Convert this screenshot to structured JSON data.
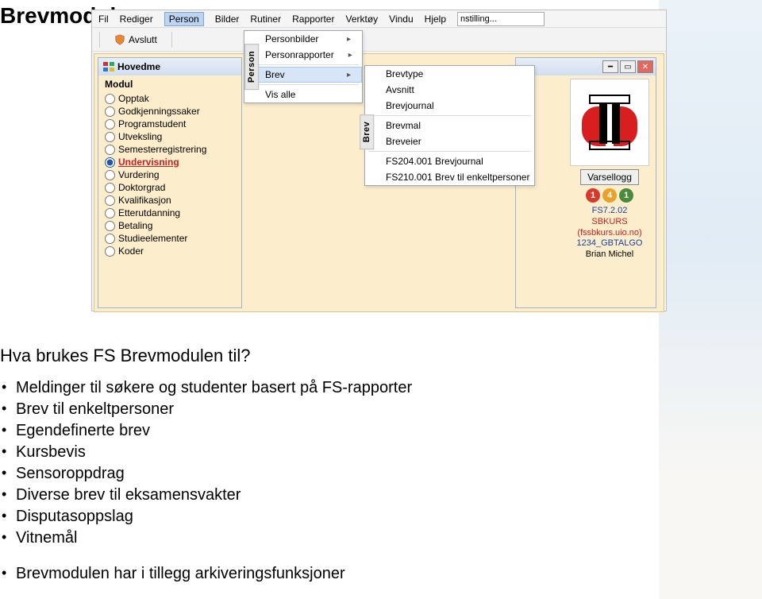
{
  "slide_title": "Brevmodulen",
  "menubar": [
    "Fil",
    "Rediger",
    "Person",
    "Bilder",
    "Rutiner",
    "Rapporter",
    "Verktøy",
    "Vindu",
    "Hjelp"
  ],
  "menubar_active_index": 2,
  "toolbar": {
    "avslutt": "Avslutt"
  },
  "stilling_value": "nstilling...",
  "person_menu": {
    "tab": "Person",
    "items": [
      {
        "label": "Personbilder",
        "arrow": true
      },
      {
        "label": "Personrapporter",
        "arrow": true
      },
      {
        "sep": true
      },
      {
        "label": "Brev",
        "arrow": true,
        "active": true
      },
      {
        "sep": true
      },
      {
        "label": "Vis alle"
      }
    ]
  },
  "brev_menu": {
    "tab": "Brev",
    "items": [
      {
        "label": "Brevtype"
      },
      {
        "label": "Avsnitt"
      },
      {
        "label": "Brevjournal"
      },
      {
        "sep": true
      },
      {
        "label": "Brevmal"
      },
      {
        "label": "Breveier"
      },
      {
        "sep": true
      },
      {
        "label": "FS204.001 Brevjournal"
      },
      {
        "label": "FS210.001 Brev til enkeltpersoner"
      }
    ]
  },
  "child_window": {
    "title": "Hovedme",
    "modul_header": "Modul",
    "items": [
      "Opptak",
      "Godkjenningssaker",
      "Programstudent",
      "Utveksling",
      "Semesterregistrering",
      "Undervisning",
      "Vurdering",
      "Doktorgrad",
      "Kvalifikasjon",
      "Etterutdanning",
      "Betaling",
      "Studieelementer",
      "Koder"
    ],
    "selected_index": 5
  },
  "right_panel": {
    "varsellogg": "Varsellogg",
    "badges": [
      "1",
      "4",
      "1"
    ],
    "version": "FS7.2.02",
    "user": "SBKURS",
    "host": "(fssbkurs.uio.no)",
    "code": "1234_GBTALGO",
    "name": "Brian Michel"
  },
  "content": {
    "heading": "Hva brukes FS Brevmodulen til?",
    "bullets": [
      "Meldinger til søkere og studenter basert på FS-rapporter",
      "Brev til enkeltpersoner",
      "Egendefinerte brev",
      "Kursbevis",
      "Sensoroppdrag",
      "Diverse brev til eksamensvakter",
      "Disputasoppslag",
      "Vitnemål"
    ],
    "footer_bullet": "Brevmodulen har i tillegg arkiveringsfunksjoner"
  }
}
